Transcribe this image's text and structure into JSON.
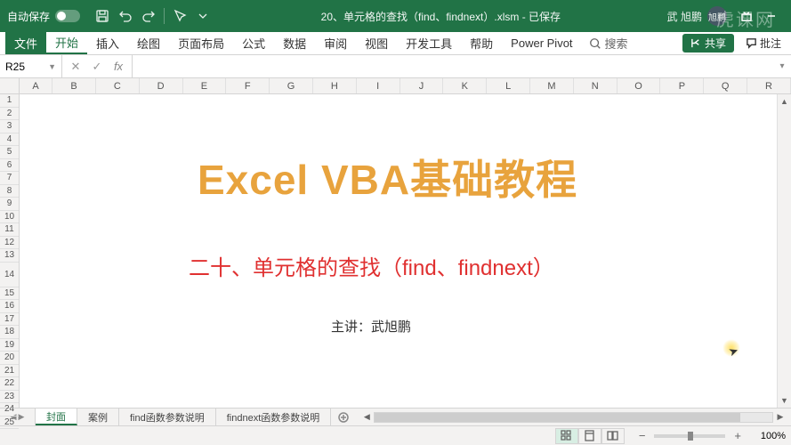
{
  "titlebar": {
    "autosave_label": "自动保存",
    "doc_title": "20、单元格的查找（find、findnext）.xlsm - 已保存",
    "user_name": "武 旭鹏",
    "user_initials": "旭鹏"
  },
  "ribbon": {
    "tabs": [
      "文件",
      "开始",
      "插入",
      "绘图",
      "页面布局",
      "公式",
      "数据",
      "审阅",
      "视图",
      "开发工具",
      "帮助",
      "Power Pivot"
    ],
    "search_label": "搜索",
    "share_label": "共享",
    "comments_label": "批注"
  },
  "formula_bar": {
    "name_box_value": "R25",
    "cancel_glyph": "✕",
    "enter_glyph": "✓",
    "fx_glyph": "fx",
    "formula_value": ""
  },
  "columns": [
    "A",
    "B",
    "C",
    "D",
    "E",
    "F",
    "G",
    "H",
    "I",
    "J",
    "K",
    "L",
    "M",
    "N",
    "O",
    "P",
    "Q",
    "R"
  ],
  "row_count": 25,
  "tall_row": 14,
  "content": {
    "title": "Excel VBA基础教程",
    "subtitle": "二十、单元格的查找（find、findnext）",
    "author": "主讲：武旭鹏"
  },
  "sheets": {
    "tabs": [
      "封面",
      "案例",
      "find函数参数说明",
      "findnext函数参数说明"
    ],
    "active_index": 0
  },
  "statusbar": {
    "zoom_pct": "100%"
  },
  "watermark": "虎课网"
}
